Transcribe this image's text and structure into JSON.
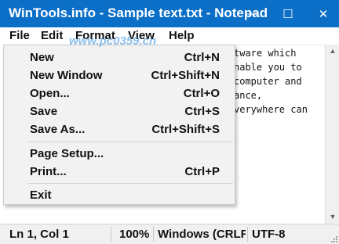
{
  "window": {
    "title": "WinTools.info - Sample text.txt - Notepad",
    "minimize_glyph": "—",
    "maximize_glyph": "☐",
    "close_glyph": "✕",
    "title_bar_color": "#0b6fc7"
  },
  "menubar": {
    "file": "File",
    "edit": "Edit",
    "format": "Format",
    "view": "View",
    "help": "Help"
  },
  "editor": {
    "lines": [
      "tware which",
      "nable you to",
      " computer and",
      "ance,",
      "verywhere can"
    ]
  },
  "file_menu": {
    "items": [
      {
        "label": "New",
        "shortcut": "Ctrl+N"
      },
      {
        "label": "New Window",
        "shortcut": "Ctrl+Shift+N"
      },
      {
        "label": "Open...",
        "shortcut": "Ctrl+O"
      },
      {
        "label": "Save",
        "shortcut": "Ctrl+S"
      },
      {
        "label": "Save As...",
        "shortcut": "Ctrl+Shift+S"
      },
      {
        "label": "Page Setup...",
        "shortcut": ""
      },
      {
        "label": "Print...",
        "shortcut": "Ctrl+P"
      },
      {
        "label": "Exit",
        "shortcut": ""
      }
    ]
  },
  "statusbar": {
    "position": "Ln 1, Col 1",
    "zoom": "100%",
    "line_ending": "Windows (CRLF)",
    "encoding": "UTF-8"
  },
  "watermark": {
    "text": "www.pc0359.cn"
  }
}
